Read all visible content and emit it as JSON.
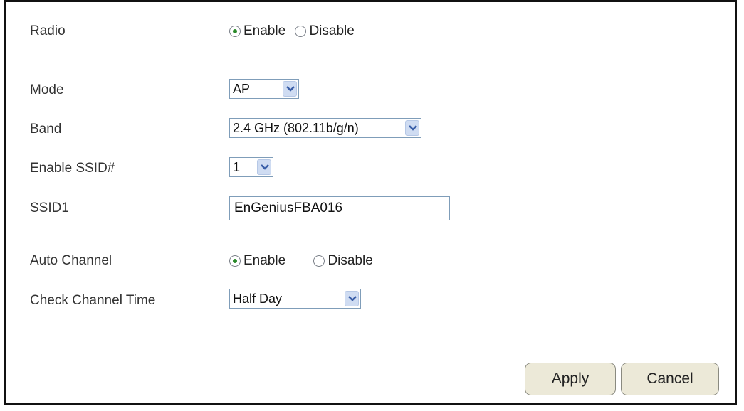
{
  "radio": {
    "label": "Radio",
    "options": [
      {
        "label": "Enable",
        "selected": true
      },
      {
        "label": "Disable",
        "selected": false
      }
    ]
  },
  "mode": {
    "label": "Mode",
    "value": "AP"
  },
  "band": {
    "label": "Band",
    "value": "2.4 GHz (802.11b/g/n)"
  },
  "enable_ssid": {
    "label": "Enable SSID#",
    "value": "1"
  },
  "ssid1": {
    "label": "SSID1",
    "value": "EnGeniusFBA016"
  },
  "auto_channel": {
    "label": "Auto Channel",
    "options": [
      {
        "label": "Enable",
        "selected": true
      },
      {
        "label": "Disable",
        "selected": false
      }
    ]
  },
  "check_channel_time": {
    "label": "Check Channel Time",
    "value": "Half Day"
  },
  "buttons": {
    "apply": "Apply",
    "cancel": "Cancel"
  },
  "icons": {
    "select_arrow": "chevron-down-icon",
    "radio_selected": "radio-selected-icon",
    "radio_unselected": "radio-unselected-icon"
  },
  "colors": {
    "radio_dot": "#2a8a2a",
    "select_border": "#7f9db9",
    "select_arrow_bg": "#cfdcf2",
    "button_bg": "#ece9d8"
  }
}
